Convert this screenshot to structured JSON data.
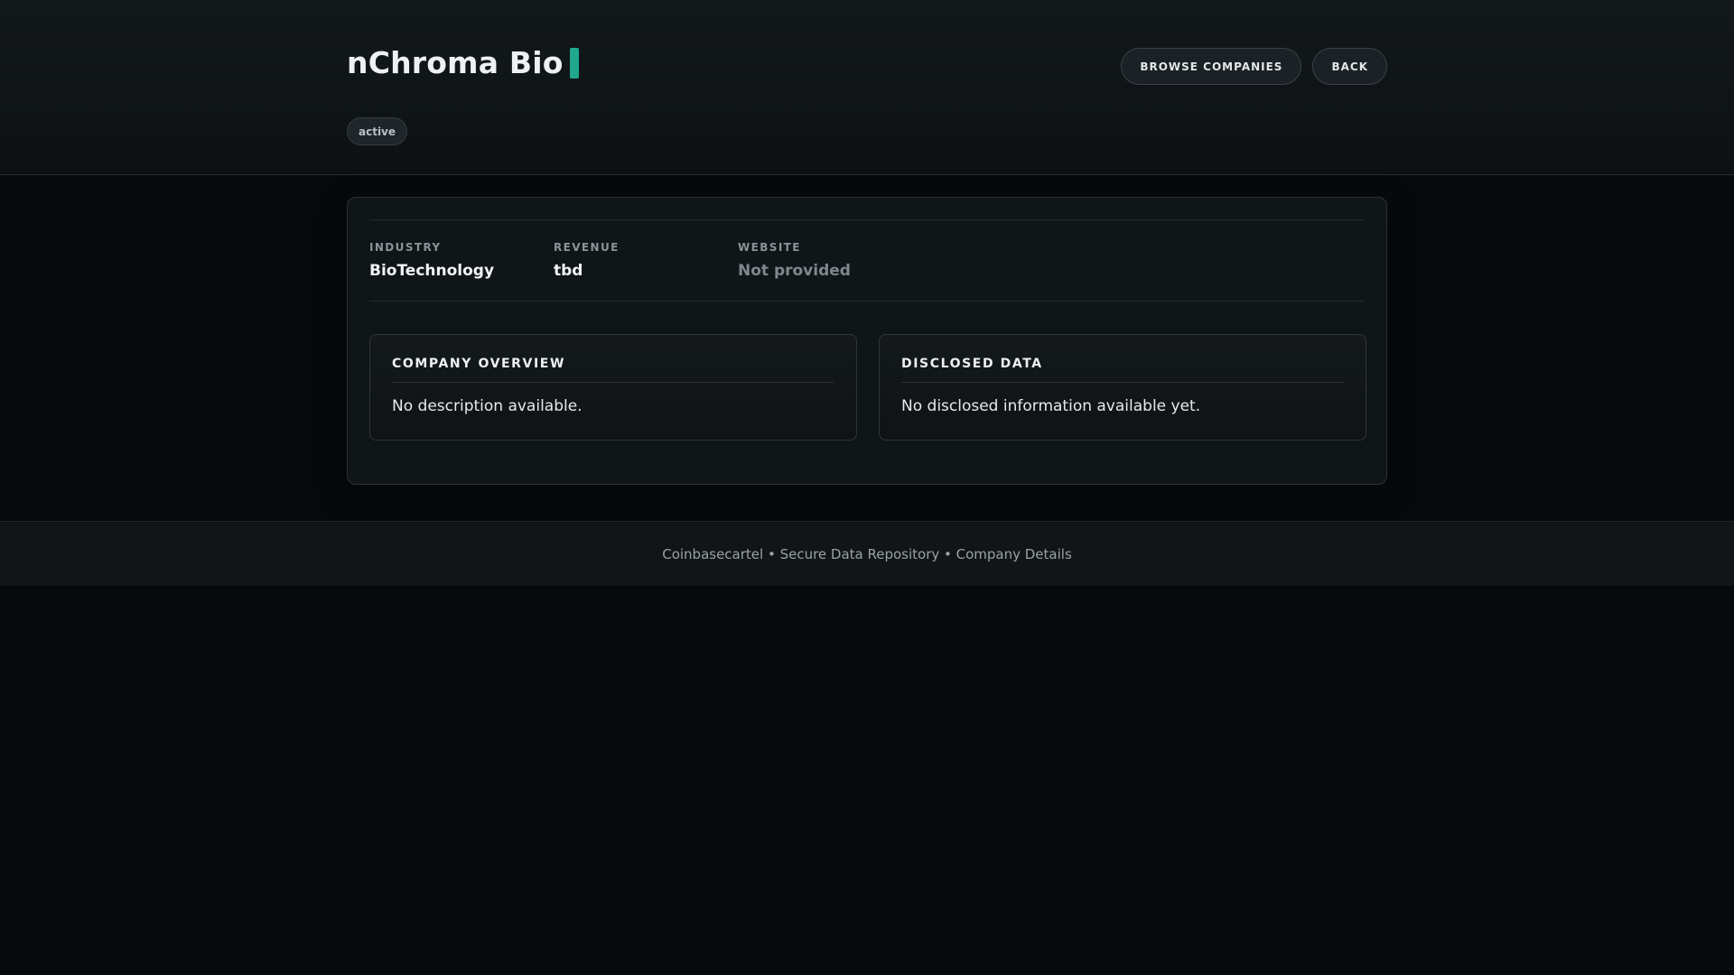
{
  "header": {
    "title": "nChroma Bio",
    "status": "active",
    "accent_color": "#1fa88e",
    "buttons": {
      "browse": "BROWSE COMPANIES",
      "back": "BACK"
    }
  },
  "meta": {
    "industry": {
      "label": "INDUSTRY",
      "value": "BioTechnology"
    },
    "revenue": {
      "label": "REVENUE",
      "value": "tbd"
    },
    "website": {
      "label": "WEBSITE",
      "value": "Not provided"
    }
  },
  "panels": {
    "overview": {
      "title": "COMPANY OVERVIEW",
      "body": "No description available."
    },
    "disclosed": {
      "title": "DISCLOSED DATA",
      "body": "No disclosed information available yet."
    }
  },
  "footer": {
    "text": "Coinbasecartel • Secure Data Repository • Company Details"
  }
}
